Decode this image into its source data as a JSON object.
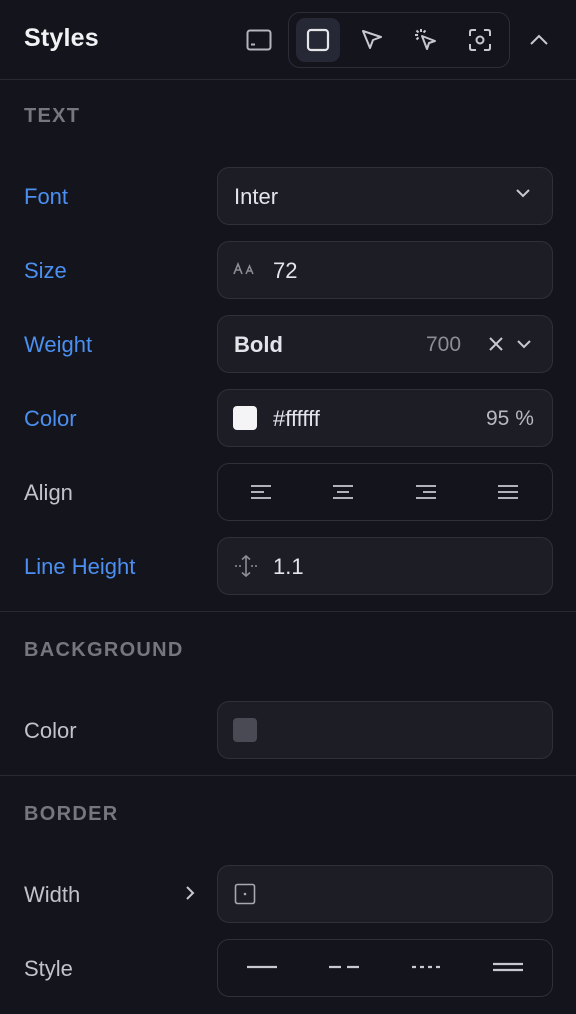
{
  "header": {
    "title": "Styles"
  },
  "sections": {
    "text": "TEXT",
    "background": "BACKGROUND",
    "border": "BORDER"
  },
  "text": {
    "font": {
      "label": "Font",
      "value": "Inter"
    },
    "size": {
      "label": "Size",
      "value": "72"
    },
    "weight": {
      "label": "Weight",
      "value": "Bold",
      "numeric": "700"
    },
    "color": {
      "label": "Color",
      "value": "#ffffff",
      "opacity": "95 %",
      "swatch": "#f4f4f6"
    },
    "align": {
      "label": "Align"
    },
    "line_height": {
      "label": "Line Height",
      "value": "1.1"
    }
  },
  "background": {
    "color": {
      "label": "Color",
      "swatch": "#4a4a55"
    }
  },
  "border": {
    "width": {
      "label": "Width"
    },
    "style": {
      "label": "Style"
    }
  },
  "colors": {
    "accent": "#4b8ff0",
    "panel": "#14141c",
    "field": "#1d1d26"
  }
}
